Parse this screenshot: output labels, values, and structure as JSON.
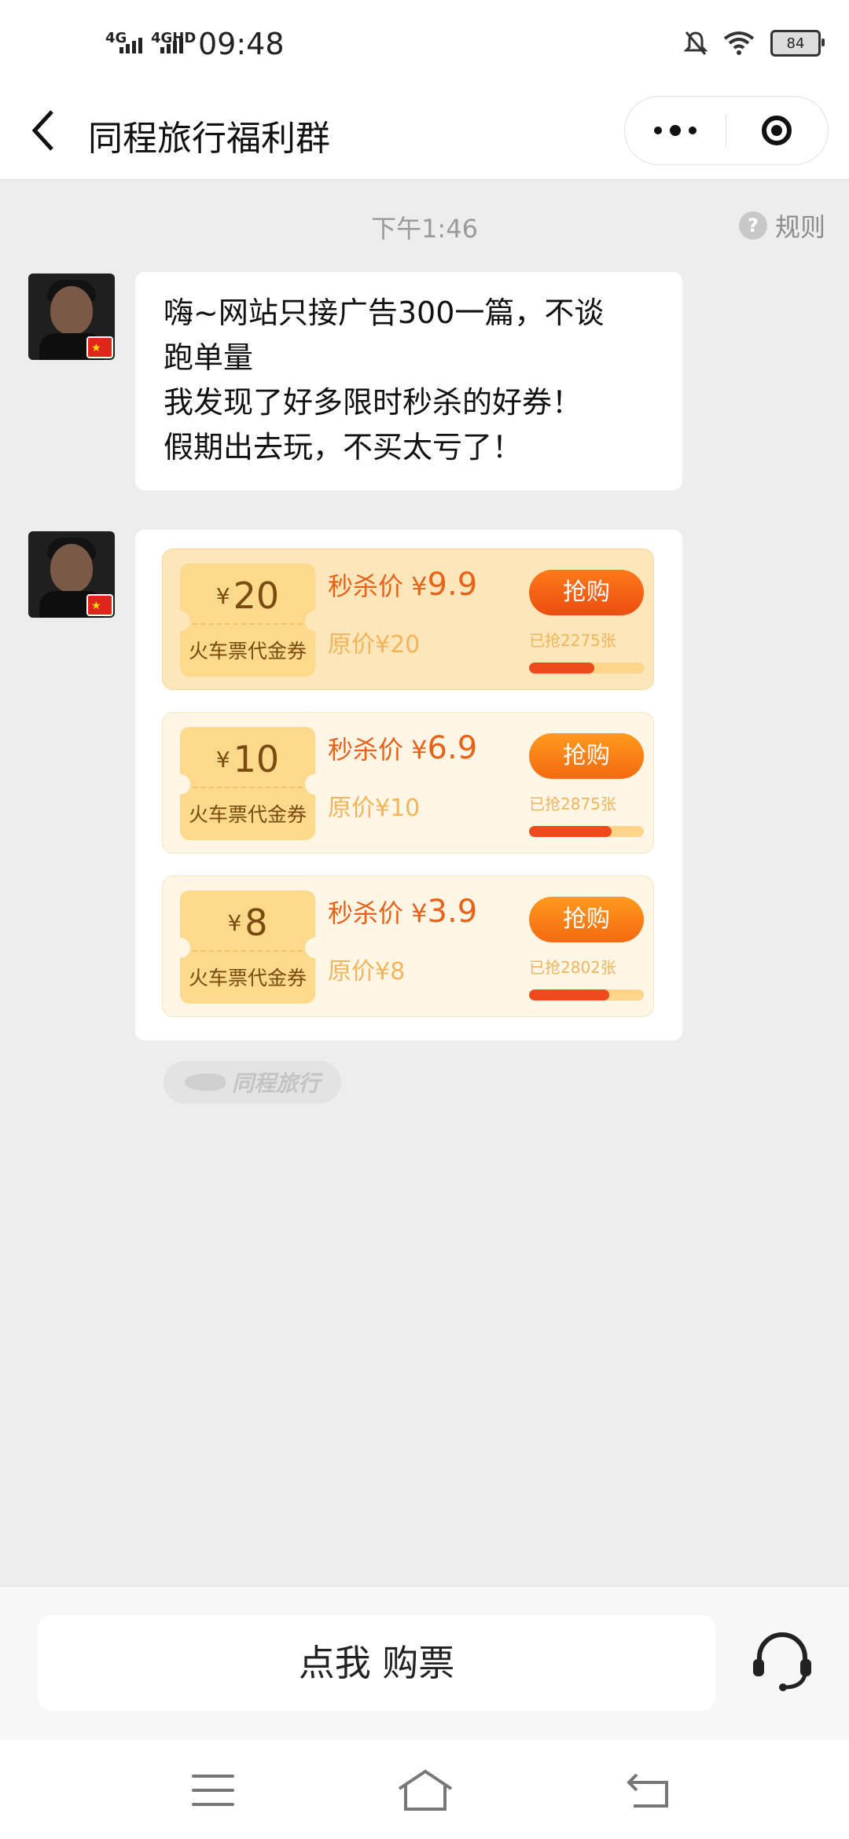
{
  "status_bar": {
    "net1": "4G",
    "net2": "4GHD",
    "time": "09:48",
    "battery": "84"
  },
  "nav": {
    "title": "同程旅行福利群"
  },
  "chat": {
    "time_label": "下午1:46",
    "rules_label": "规则",
    "message_lines": [
      "嗨~网站只接广告300一篇，不谈",
      "跑单量",
      "我发现了好多限时秒杀的好券！",
      "假期出去玩，不买太亏了！"
    ]
  },
  "coupons": [
    {
      "currency": "¥",
      "amount": "20",
      "label": "火车票代金券",
      "sale_prefix": "秒杀价 ¥",
      "sale_price": "9.9",
      "original": "原价¥20",
      "buy_label": "抢购",
      "sold": "已抢2275张",
      "progress": 0.57
    },
    {
      "currency": "¥",
      "amount": "10",
      "label": "火车票代金券",
      "sale_prefix": "秒杀价 ¥",
      "sale_price": "6.9",
      "original": "原价¥10",
      "buy_label": "抢购",
      "sold": "已抢2875张",
      "progress": 0.72
    },
    {
      "currency": "¥",
      "amount": "8",
      "label": "火车票代金券",
      "sale_prefix": "秒杀价 ¥",
      "sale_price": "3.9",
      "original": "原价¥8",
      "buy_label": "抢购",
      "sold": "已抢2802张",
      "progress": 0.7
    }
  ],
  "brand": {
    "name": "同程旅行"
  },
  "bottom": {
    "ticket_button": "点我 购票"
  },
  "colors": {
    "accent_orange": "#f46a10",
    "progress_red": "#ee4a1b",
    "chat_background": "#ededed"
  },
  "icons": {
    "back": "chevron-left-icon",
    "more": "more-dots-icon",
    "close": "target-close-icon",
    "help": "question-circle-icon",
    "customer_service": "headset-icon",
    "flag": "china-flag-icon"
  }
}
